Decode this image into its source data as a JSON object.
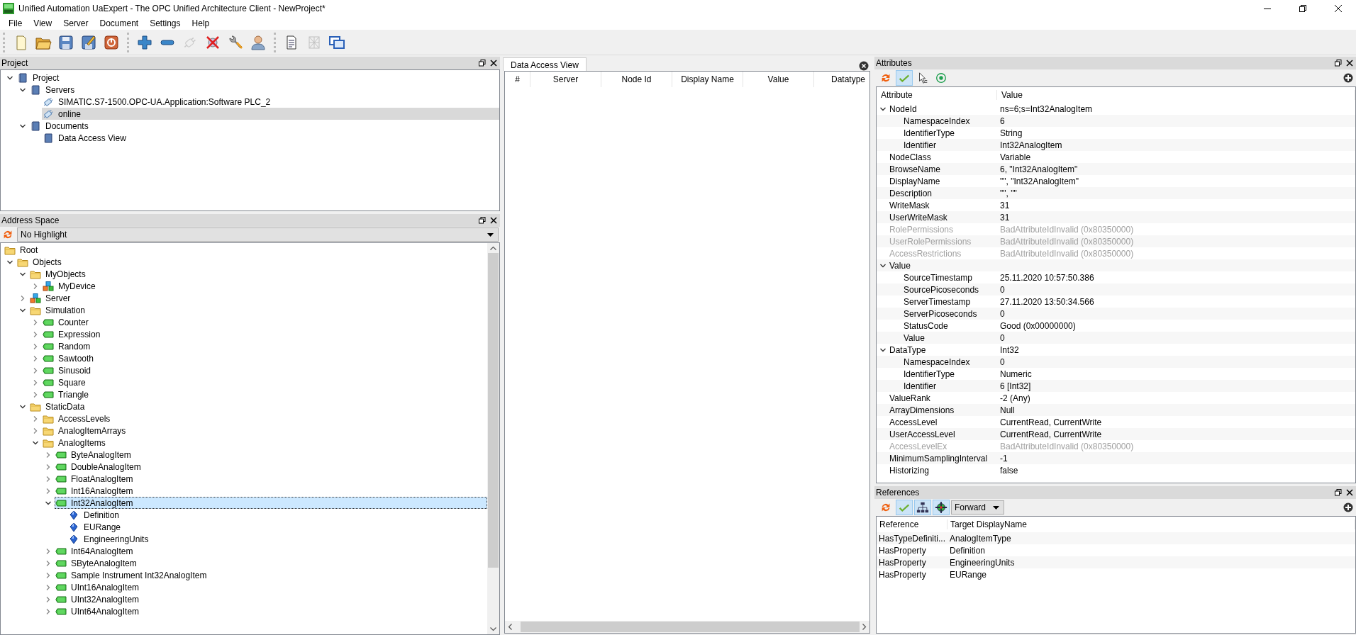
{
  "window": {
    "title": "Unified Automation UaExpert - The OPC Unified Architecture Client - NewProject*"
  },
  "menu": [
    "File",
    "View",
    "Server",
    "Document",
    "Settings",
    "Help"
  ],
  "toolbar": [
    [
      {
        "kind": "new",
        "disabled": false
      },
      {
        "kind": "open",
        "disabled": false
      },
      {
        "kind": "save",
        "disabled": false
      },
      {
        "kind": "save-as",
        "disabled": false
      },
      {
        "kind": "power",
        "disabled": false
      }
    ],
    [
      {
        "kind": "add",
        "disabled": false
      },
      {
        "kind": "remove",
        "disabled": false
      },
      {
        "kind": "connect",
        "disabled": true
      },
      {
        "kind": "disconnect",
        "disabled": false
      },
      {
        "kind": "settings",
        "disabled": false
      },
      {
        "kind": "user",
        "disabled": false
      }
    ],
    [
      {
        "kind": "document",
        "disabled": false
      },
      {
        "kind": "grid",
        "disabled": true
      },
      {
        "kind": "windows",
        "disabled": false
      }
    ]
  ],
  "project": {
    "title": "Project",
    "focused": false,
    "tree": [
      {
        "label": "Project",
        "kind": "book",
        "expanded": true,
        "selected": false,
        "children": [
          {
            "label": "Servers",
            "kind": "book",
            "expanded": true,
            "selected": false,
            "children": [
              {
                "label": "SIMATIC.S7-1500.OPC-UA.Application:Software PLC_2",
                "kind": "plug",
                "selected": false
              },
              {
                "label": "online",
                "kind": "plug",
                "selected": true
              }
            ]
          },
          {
            "label": "Documents",
            "kind": "book",
            "expanded": true,
            "selected": false,
            "children": [
              {
                "label": "Data Access View",
                "kind": "book",
                "selected": false
              }
            ]
          }
        ]
      }
    ]
  },
  "address_space": {
    "title": "Address Space",
    "highlight": "No Highlight",
    "focused": true,
    "tree": [
      {
        "label": "Root",
        "kind": "folder",
        "selected": false,
        "children": [
          {
            "label": "Objects",
            "kind": "folder",
            "expanded": true,
            "selected": false,
            "children": [
              {
                "label": "MyObjects",
                "kind": "folder",
                "expanded": true,
                "selected": false,
                "children": [
                  {
                    "label": "MyDevice",
                    "kind": "objects",
                    "expanded": false,
                    "selected": false
                  }
                ]
              },
              {
                "label": "Server",
                "kind": "objects",
                "expanded": false,
                "selected": false
              },
              {
                "label": "Simulation",
                "kind": "folder",
                "expanded": true,
                "selected": false,
                "children": [
                  {
                    "label": "Counter",
                    "kind": "variable",
                    "expanded": false,
                    "selected": false
                  },
                  {
                    "label": "Expression",
                    "kind": "variable",
                    "expanded": false,
                    "selected": false
                  },
                  {
                    "label": "Random",
                    "kind": "variable",
                    "expanded": false,
                    "selected": false
                  },
                  {
                    "label": "Sawtooth",
                    "kind": "variable",
                    "expanded": false,
                    "selected": false
                  },
                  {
                    "label": "Sinusoid",
                    "kind": "variable",
                    "expanded": false,
                    "selected": false
                  },
                  {
                    "label": "Square",
                    "kind": "variable",
                    "expanded": false,
                    "selected": false
                  },
                  {
                    "label": "Triangle",
                    "kind": "variable",
                    "expanded": false,
                    "selected": false
                  }
                ]
              },
              {
                "label": "StaticData",
                "kind": "folder",
                "expanded": true,
                "selected": false,
                "children": [
                  {
                    "label": "AccessLevels",
                    "kind": "folder",
                    "expanded": false,
                    "selected": false
                  },
                  {
                    "label": "AnalogItemArrays",
                    "kind": "folder",
                    "expanded": false,
                    "selected": false
                  },
                  {
                    "label": "AnalogItems",
                    "kind": "folder",
                    "expanded": true,
                    "selected": false,
                    "children": [
                      {
                        "label": "ByteAnalogItem",
                        "kind": "variable",
                        "expanded": false,
                        "selected": false
                      },
                      {
                        "label": "DoubleAnalogItem",
                        "kind": "variable",
                        "expanded": false,
                        "selected": false
                      },
                      {
                        "label": "FloatAnalogItem",
                        "kind": "variable",
                        "expanded": false,
                        "selected": false
                      },
                      {
                        "label": "Int16AnalogItem",
                        "kind": "variable",
                        "expanded": false,
                        "selected": false
                      },
                      {
                        "label": "Int32AnalogItem",
                        "kind": "variable",
                        "expanded": true,
                        "selected": true,
                        "children": [
                          {
                            "label": "Definition",
                            "kind": "property",
                            "selected": false
                          },
                          {
                            "label": "EURange",
                            "kind": "property",
                            "selected": false
                          },
                          {
                            "label": "EngineeringUnits",
                            "kind": "property",
                            "selected": false
                          }
                        ]
                      },
                      {
                        "label": "Int64AnalogItem",
                        "kind": "variable",
                        "expanded": false,
                        "selected": false
                      },
                      {
                        "label": "SByteAnalogItem",
                        "kind": "variable",
                        "expanded": false,
                        "selected": false
                      },
                      {
                        "label": "Sample Instrument Int32AnalogItem",
                        "kind": "variable",
                        "expanded": false,
                        "selected": false
                      },
                      {
                        "label": "UInt16AnalogItem",
                        "kind": "variable",
                        "expanded": false,
                        "selected": false
                      },
                      {
                        "label": "UInt32AnalogItem",
                        "kind": "variable",
                        "expanded": false,
                        "selected": false
                      },
                      {
                        "label": "UInt64AnalogItem",
                        "kind": "variable",
                        "expanded": false,
                        "selected": false
                      }
                    ]
                  }
                ]
              }
            ]
          }
        ]
      }
    ]
  },
  "data_access": {
    "tab": "Data Access View",
    "columns": [
      "#",
      "Server",
      "Node Id",
      "Display Name",
      "Value",
      "Datatype"
    ]
  },
  "attributes": {
    "title": "Attributes",
    "tools": [
      {
        "kind": "refresh",
        "pressed": false
      },
      {
        "kind": "check",
        "pressed": true
      },
      {
        "kind": "cursor",
        "pressed": false
      },
      {
        "kind": "target",
        "pressed": false
      }
    ],
    "columns": [
      "Attribute",
      "Value"
    ],
    "rows": [
      {
        "name": "NodeId",
        "value": "ns=6;s=Int32AnalogItem",
        "disabled": false,
        "expanded": true,
        "children": [
          {
            "name": "NamespaceIndex",
            "value": "6",
            "disabled": false
          },
          {
            "name": "IdentifierType",
            "value": "String",
            "disabled": false
          },
          {
            "name": "Identifier",
            "value": "Int32AnalogItem",
            "disabled": false
          }
        ]
      },
      {
        "name": "NodeClass",
        "value": "Variable",
        "disabled": false
      },
      {
        "name": "BrowseName",
        "value": "6, \"Int32AnalogItem\"",
        "disabled": false
      },
      {
        "name": "DisplayName",
        "value": "\"\", \"Int32AnalogItem\"",
        "disabled": false
      },
      {
        "name": "Description",
        "value": "\"\", \"\"",
        "disabled": false
      },
      {
        "name": "WriteMask",
        "value": "31",
        "disabled": false
      },
      {
        "name": "UserWriteMask",
        "value": "31",
        "disabled": false
      },
      {
        "name": "RolePermissions",
        "value": "BadAttributeIdInvalid (0x80350000)",
        "disabled": true
      },
      {
        "name": "UserRolePermissions",
        "value": "BadAttributeIdInvalid (0x80350000)",
        "disabled": true
      },
      {
        "name": "AccessRestrictions",
        "value": "BadAttributeIdInvalid (0x80350000)",
        "disabled": true
      },
      {
        "name": "Value",
        "disabled": false,
        "expanded": true,
        "children": [
          {
            "name": "SourceTimestamp",
            "value": "25.11.2020 10:57:50.386",
            "disabled": false
          },
          {
            "name": "SourcePicoseconds",
            "value": "0",
            "disabled": false
          },
          {
            "name": "ServerTimestamp",
            "value": "27.11.2020 13:50:34.566",
            "disabled": false
          },
          {
            "name": "ServerPicoseconds",
            "value": "0",
            "disabled": false
          },
          {
            "name": "StatusCode",
            "value": "Good (0x00000000)",
            "disabled": false
          },
          {
            "name": "Value",
            "value": "0",
            "disabled": false
          }
        ]
      },
      {
        "name": "DataType",
        "value": "Int32",
        "disabled": false,
        "expanded": true,
        "children": [
          {
            "name": "NamespaceIndex",
            "value": "0",
            "disabled": false
          },
          {
            "name": "IdentifierType",
            "value": "Numeric",
            "disabled": false
          },
          {
            "name": "Identifier",
            "value": "6 [Int32]",
            "disabled": false
          }
        ]
      },
      {
        "name": "ValueRank",
        "value": "-2 (Any)",
        "disabled": false
      },
      {
        "name": "ArrayDimensions",
        "value": "Null",
        "disabled": false
      },
      {
        "name": "AccessLevel",
        "value": "CurrentRead, CurrentWrite",
        "disabled": false
      },
      {
        "name": "UserAccessLevel",
        "value": "CurrentRead, CurrentWrite",
        "disabled": false
      },
      {
        "name": "AccessLevelEx",
        "value": "BadAttributeIdInvalid (0x80350000)",
        "disabled": true
      },
      {
        "name": "MinimumSamplingInterval",
        "value": "-1",
        "disabled": false
      },
      {
        "name": "Historizing",
        "value": "false",
        "disabled": false
      }
    ]
  },
  "references": {
    "title": "References",
    "tools": [
      {
        "kind": "refresh",
        "pressed": false
      },
      {
        "kind": "check",
        "pressed": true
      },
      {
        "kind": "hierarchy",
        "pressed": true
      },
      {
        "kind": "crosshair",
        "pressed": true
      }
    ],
    "direction": "Forward",
    "columns": [
      "Reference",
      "Target DisplayName"
    ],
    "rows": [
      [
        "HasTypeDefiniti...",
        "AnalogItemType"
      ],
      [
        "HasProperty",
        "Definition"
      ],
      [
        "HasProperty",
        "EngineeringUnits"
      ],
      [
        "HasProperty",
        "EURange"
      ]
    ]
  }
}
